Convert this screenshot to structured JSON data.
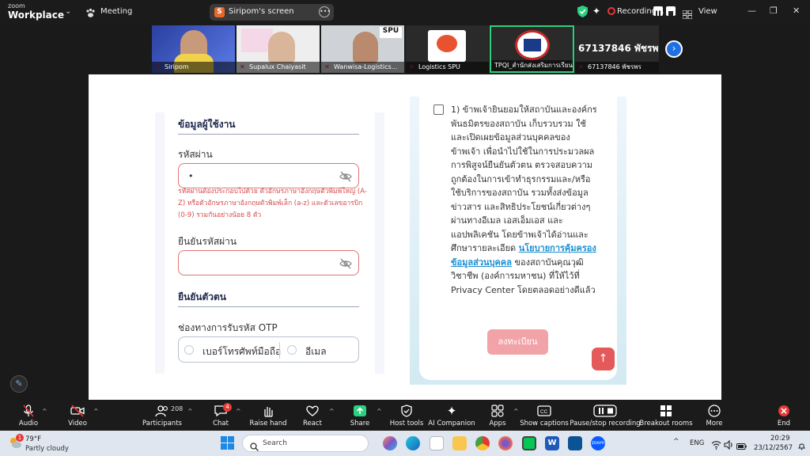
{
  "app": {
    "logo_top": "zoom",
    "logo_bottom": "Workplace"
  },
  "topbar": {
    "meeting_label": "Meeting",
    "share_label": "Siripom's screen",
    "share_initial": "S",
    "recording_label": "Recording...",
    "view_label": "View"
  },
  "participants_strip": [
    {
      "name": "Siripom"
    },
    {
      "name": "Supalux Chaiyasit"
    },
    {
      "name": "Wanwisa-Logistics..."
    },
    {
      "name": "Logistics SPU"
    },
    {
      "name": "TPQI_สำนักส่งเสริมการเรียนรู้..."
    },
    {
      "name": "67137846 พัชรพร",
      "big_label": "67137846 พัชรพร"
    }
  ],
  "form": {
    "section_user": "ข้อมูลผู้ใช้งาน",
    "password_label": "รหัสผ่าน",
    "password_value": "•",
    "password_error": "รหัสผ่านต้องประกอบไปด้วย ตัวอักษรภาษาอังกฤษตัวพิมพ์ใหญ่ (A-Z) หรือตัวอักษรภาษาอังกฤษตัวพิมพ์เล็ก (a-z) และตัวเลขอารบิก (0-9) รวมกันอย่างน้อย 8 ตัว",
    "confirm_label": "ยืนยันรหัสผ่าน",
    "section_verify": "ยืนยันตัวตน",
    "otp_label": "ช่องทางการรับรหัส OTP",
    "otp_options": [
      "เบอร์โทรศัพท์มือถือ",
      "อีเมล"
    ],
    "consent_before": "1) ข้าพเจ้ายินยอมให้สถาบันและองค์กรพันธมิตรของสถาบัน เก็บรวบรวม ใช้ และเปิดเผยข้อมูลส่วนบุคคลของข้าพเจ้า เพื่อนำไปใช้ในการประมวลผลการพิสูจน์ยืนยันตัวตน ตรวจสอบความถูกต้องในการเข้าทำธุรกรรมและ/หรือใช้บริการของสถาบัน รวมทั้งส่งข้อมูลข่าวสาร และสิทธิประโยชน์เกี่ยวต่างๆ ผ่านทางอีเมล เอสเอ็มเอส และแอปพลิเคชัน โดยข้าพเจ้าได้อ่านและศึกษารายละเอียด ",
    "consent_link": "นโยบายการคุ้มครองข้อมูลส่วนบุคคล",
    "consent_after": " ของสถาบันคุณวุฒิวิชาชีพ (องค์การมหาชน) ที่ให้ไว้ที่ Privacy Center โดยตลอดอย่างดีแล้ว",
    "register_label": "ลงทะเบียน"
  },
  "toolbar": {
    "audio": "Audio",
    "video": "Video",
    "participants": "Participants",
    "participants_count": "208",
    "chat": "Chat",
    "chat_badge": "4",
    "raise_hand": "Raise hand",
    "react": "React",
    "share": "Share",
    "host_tools": "Host tools",
    "ai_companion": "AI Companion",
    "apps": "Apps",
    "captions": "Show captions",
    "recording": "Pause/stop recording",
    "breakout": "Breakout rooms",
    "more": "More",
    "end": "End"
  },
  "taskbar": {
    "weather_temp": "79°F",
    "weather_desc": "Partly cloudy",
    "weather_badge": "1",
    "search_label": "Search",
    "lang": "ENG",
    "time": "20:29",
    "date": "23/12/2567"
  },
  "colors": {
    "zoom_blue": "#1f6fe5",
    "error_red": "#d84b4b",
    "register_pink": "#f2a3a8",
    "active_speaker": "#2bd17e"
  }
}
